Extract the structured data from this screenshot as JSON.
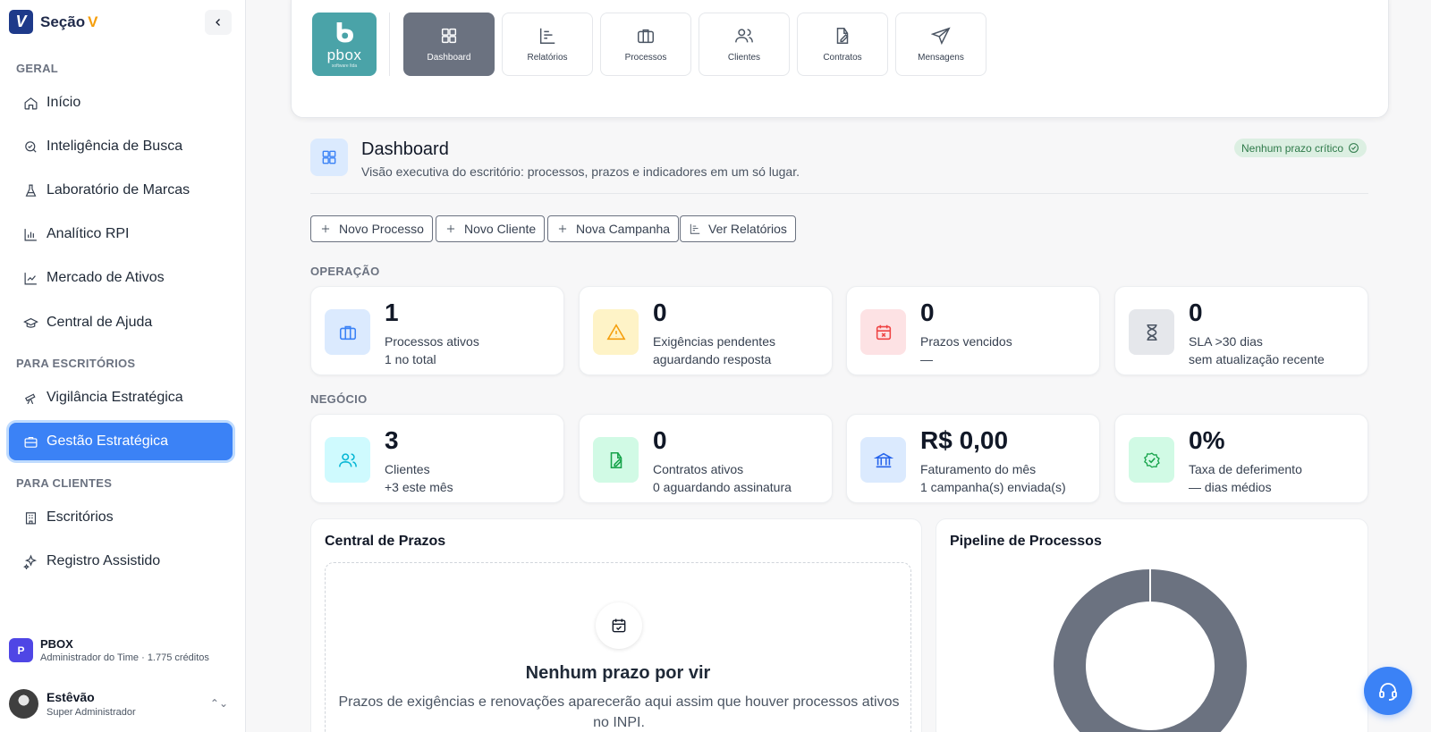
{
  "sidebar": {
    "brand_name": "Seção",
    "brand_accent": "V",
    "logo_letter": "V",
    "sections": [
      {
        "label": "GERAL"
      },
      {
        "label": "PARA ESCRITÓRIOS"
      },
      {
        "label": "PARA CLIENTES"
      }
    ],
    "items": [
      {
        "label": "Início",
        "icon": "home-icon"
      },
      {
        "label": "Inteligência de Busca",
        "icon": "search-icon"
      },
      {
        "label": "Laboratório de Marcas",
        "icon": "flask-icon"
      },
      {
        "label": "Analítico RPI",
        "icon": "bar-chart-icon"
      },
      {
        "label": "Mercado de Ativos",
        "icon": "line-chart-icon"
      },
      {
        "label": "Central de Ajuda",
        "icon": "graduation-cap-icon"
      },
      {
        "label": "Vigilância Estratégica",
        "icon": "telescope-icon"
      },
      {
        "label": "Gestão Estratégica",
        "icon": "briefcase-icon",
        "active": true
      },
      {
        "label": "Escritórios",
        "icon": "building-icon"
      },
      {
        "label": "Registro Assistido",
        "icon": "sparkles-icon"
      }
    ],
    "org": {
      "avatar": "P",
      "name": "PBOX",
      "subtitle": "Administrador do Time · 1.775 créditos"
    },
    "user": {
      "name": "Estêvão",
      "role": "Super Administrador"
    }
  },
  "topbar": {
    "logo_text": "pbox",
    "logo_sub": "software ltda",
    "tools": [
      {
        "label": "Dashboard",
        "icon": "dashboard-icon",
        "active": true
      },
      {
        "label": "Relatórios",
        "icon": "reports-icon"
      },
      {
        "label": "Processos",
        "icon": "briefcase-icon"
      },
      {
        "label": "Clientes",
        "icon": "users-icon"
      },
      {
        "label": "Contratos",
        "icon": "contract-icon"
      },
      {
        "label": "Mensagens",
        "icon": "send-icon"
      }
    ]
  },
  "header": {
    "title": "Dashboard",
    "subtitle": "Visão executiva do escritório: processos, prazos e indicadores em um só lugar.",
    "badge": "Nenhum prazo crítico"
  },
  "actions": [
    {
      "label": "Novo Processo",
      "icon": "plus-icon"
    },
    {
      "label": "Novo Cliente",
      "icon": "plus-icon"
    },
    {
      "label": "Nova Campanha",
      "icon": "plus-icon"
    },
    {
      "label": "Ver Relatórios",
      "icon": "reports-icon"
    }
  ],
  "operacao": {
    "label": "OPERAÇÃO",
    "cards": [
      {
        "value": "1",
        "label": "Processos ativos",
        "sub": "1 no total",
        "icon": "briefcase-icon",
        "bg": "#dbeafe",
        "fg": "#3b82f6"
      },
      {
        "value": "0",
        "label": "Exigências pendentes",
        "sub": "aguardando resposta",
        "icon": "warning-icon",
        "bg": "#fef3c7",
        "fg": "#f59e0b"
      },
      {
        "value": "0",
        "label": "Prazos vencidos",
        "sub": "—",
        "icon": "calendar-x-icon",
        "bg": "#fde2e4",
        "fg": "#ef4444"
      },
      {
        "value": "0",
        "label": "SLA >30 dias",
        "sub": "sem atualização recente",
        "icon": "hourglass-icon",
        "bg": "#e5e7eb",
        "fg": "#4b5563"
      }
    ]
  },
  "negocio": {
    "label": "NEGÓCIO",
    "cards": [
      {
        "value": "3",
        "label": "Clientes",
        "sub": "+3 este mês",
        "icon": "users-icon",
        "bg": "#cffafe",
        "fg": "#06b6d4"
      },
      {
        "value": "0",
        "label": "Contratos ativos",
        "sub": "0 aguardando assinatura",
        "icon": "contract-icon",
        "bg": "#d1fae5",
        "fg": "#16a34a"
      },
      {
        "value": "R$ 0,00",
        "label": "Faturamento do mês",
        "sub": "1 campanha(s) enviada(s)",
        "icon": "bank-icon",
        "bg": "#dbeafe",
        "fg": "#2563eb"
      },
      {
        "value": "0%",
        "label": "Taxa de deferimento",
        "sub": "— dias médios",
        "icon": "check-badge-icon",
        "bg": "#d1fae5",
        "fg": "#16a34a"
      }
    ]
  },
  "prazos": {
    "title": "Central de Prazos",
    "empty_title": "Nenhum prazo por vir",
    "empty_text": "Prazos de exigências e renovações aparecerão aqui assim que houver processos ativos no INPI."
  },
  "pipeline": {
    "title": "Pipeline de Processos",
    "color": "#6b7280"
  },
  "colors": {
    "accent": "#3b82f6",
    "brand": "#1e3a8a",
    "brand_accent": "#f59e0b"
  }
}
